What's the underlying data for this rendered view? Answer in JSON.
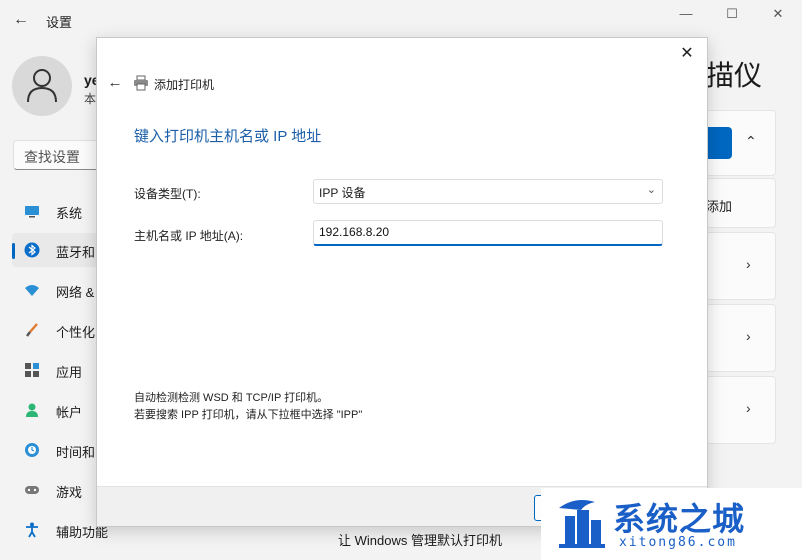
{
  "settings": {
    "title": "设置",
    "profile": {
      "name": "ye",
      "sub": "本"
    },
    "search_placeholder": "查找设置",
    "nav": [
      {
        "label": "系统",
        "icon": "monitor-icon",
        "active": false
      },
      {
        "label": "蓝牙和",
        "icon": "bluetooth-icon",
        "active": true
      },
      {
        "label": "网络 &",
        "icon": "wifi-icon",
        "active": false
      },
      {
        "label": "个性化",
        "icon": "brush-icon",
        "active": false
      },
      {
        "label": "应用",
        "icon": "apps-icon",
        "active": false
      },
      {
        "label": "帐户",
        "icon": "account-icon",
        "active": false
      },
      {
        "label": "时间和",
        "icon": "clock-globe-icon",
        "active": false
      },
      {
        "label": "游戏",
        "icon": "gamepad-icon",
        "active": false
      },
      {
        "label": "辅助功能",
        "icon": "accessibility-icon",
        "active": false
      }
    ],
    "page_title_partial": "描仪",
    "add_text": "添加",
    "bottom_link": "让 Windows 管理默认打印机",
    "accent": "#0067c0"
  },
  "dialog": {
    "title": "添加打印机",
    "heading": "键入打印机主机名或 IP 地址",
    "device_type_label": "设备类型(T):",
    "device_type_value": "IPP 设备",
    "host_label": "主机名或 IP 地址(A):",
    "host_value": "192.168.8.20",
    "note_line1": "自动检测检测 WSD 和 TCP/IP 打印机。",
    "note_line2": "若要搜索 IPP 打印机，请从下拉框中选择 \"IPP\"",
    "heading_color": "#1c5fa8"
  },
  "watermark": {
    "text": "系统之城",
    "sub": "xitong86.com"
  }
}
